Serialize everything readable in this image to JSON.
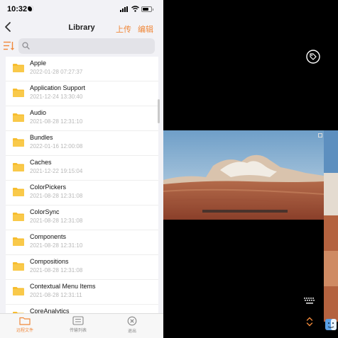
{
  "status": {
    "time": "10:32"
  },
  "nav": {
    "title": "Library",
    "upload_label": "上传",
    "edit_label": "编辑"
  },
  "search": {
    "placeholder": ""
  },
  "files": [
    {
      "name": "Apple",
      "date": "2022-01-28 07:27:37"
    },
    {
      "name": "Application Support",
      "date": "2021-12-24 13:30:40"
    },
    {
      "name": "Audio",
      "date": "2021-08-28 12:31:10"
    },
    {
      "name": "Bundles",
      "date": "2022-01-16 12:00:08"
    },
    {
      "name": "Caches",
      "date": "2021-12-22 19:15:04"
    },
    {
      "name": "ColorPickers",
      "date": "2021-08-28 12:31:08"
    },
    {
      "name": "ColorSync",
      "date": "2021-08-28 12:31:08"
    },
    {
      "name": "Components",
      "date": "2021-08-28 12:31:10"
    },
    {
      "name": "Compositions",
      "date": "2021-08-28 12:31:08"
    },
    {
      "name": "Contextual Menu Items",
      "date": "2021-08-28 12:31:11"
    },
    {
      "name": "CoreAnalytics",
      "date": ""
    }
  ],
  "tabs": [
    {
      "label": "远程文件",
      "icon": "folder-icon",
      "active": true
    },
    {
      "label": "传输列表",
      "icon": "transfer-list-icon",
      "active": false
    },
    {
      "label": "退出",
      "icon": "exit-icon",
      "active": false
    }
  ],
  "colors": {
    "accent": "#f0883a",
    "folder": "#f7bd2e",
    "background": "#f2f2f6"
  },
  "viewer": {
    "image": "desert-rock-landscape-image",
    "tag_icon": "tag-icon",
    "keyboard_icon": "keyboard-icon",
    "updown_icon": "chevron-up-down-icon"
  }
}
